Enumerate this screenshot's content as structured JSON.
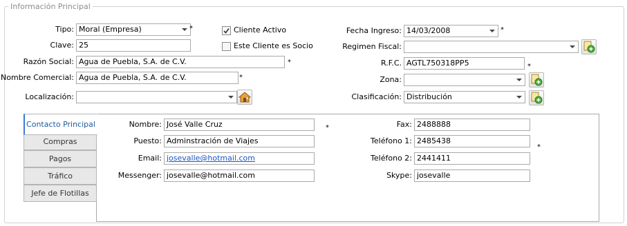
{
  "group": {
    "title": "Información Principal"
  },
  "left": {
    "tipo": {
      "label": "Tipo:",
      "value": "Moral (Empresa)"
    },
    "clave": {
      "label": "Clave:",
      "value": "25"
    },
    "razon_social": {
      "label": "Razón Social:",
      "value": "Agua de Puebla, S.A. de C.V."
    },
    "nombre_comercial": {
      "label": "Nombre Comercial:",
      "value": "Agua de Puebla, S.A. de C.V."
    },
    "localizacion": {
      "label": "Localización:",
      "value": ""
    }
  },
  "middle": {
    "cliente_activo": {
      "label": "Cliente Activo",
      "checked": true
    },
    "cliente_socio": {
      "label": "Este Cliente es Socio",
      "checked": false
    }
  },
  "right": {
    "fecha_ingreso": {
      "label": "Fecha Ingreso:",
      "value": "14/03/2008"
    },
    "regimen_fiscal": {
      "label": "Regimen Fiscal:",
      "value": ""
    },
    "rfc": {
      "label": "R.F.C.",
      "value": "AGTL750318PP5"
    },
    "zona": {
      "label": "Zona:",
      "value": ""
    },
    "clasificacion": {
      "label": "Clasificación:",
      "value": "Distribución"
    }
  },
  "required_marker": "*",
  "tabs": [
    {
      "label": "Contacto Principal",
      "active": true
    },
    {
      "label": "Compras"
    },
    {
      "label": "Pagos"
    },
    {
      "label": "Tráfico"
    },
    {
      "label": "Jefe de Flotillas"
    }
  ],
  "contact": {
    "nombre": {
      "label": "Nombre:",
      "value": "José Valle Cruz"
    },
    "puesto": {
      "label": "Puesto:",
      "value": "Adminstración de Viajes"
    },
    "email": {
      "label": "Email:",
      "value": "josevalle@hotmail.com"
    },
    "messenger": {
      "label": "Messenger:",
      "value": "josevalle@hotmail.com"
    },
    "fax": {
      "label": "Fax:",
      "value": "2488888"
    },
    "telefono1": {
      "label": "Teléfono 1:",
      "value": "2485438"
    },
    "telefono2": {
      "label": "Teléfono 2:",
      "value": "2441411"
    },
    "skype": {
      "label": "Skype:",
      "value": "josevalle"
    }
  },
  "icons": {
    "add": "add-document-icon",
    "home": "home-icon"
  }
}
